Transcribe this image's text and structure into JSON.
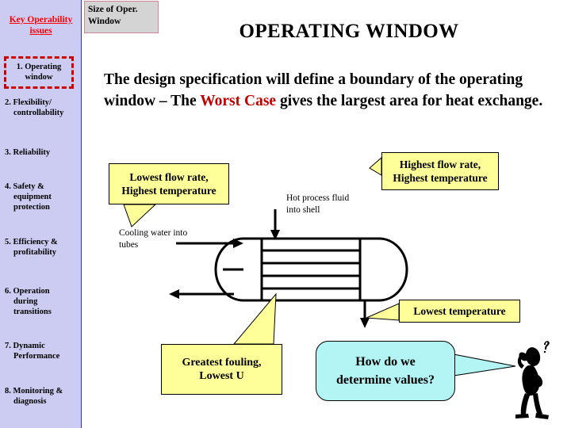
{
  "sidebar": {
    "title": "Key Operability issues",
    "items": [
      {
        "num": "1.",
        "line1": "Operating",
        "line2": "window",
        "line3": "",
        "highlighted": true
      },
      {
        "num": "2.",
        "line1": "Flexibility/",
        "line2": "controllability",
        "line3": "",
        "highlighted": false
      },
      {
        "num": "3.",
        "line1": "Reliability",
        "line2": "",
        "line3": "",
        "highlighted": false
      },
      {
        "num": "4.",
        "line1": "Safety &",
        "line2": "equipment",
        "line3": "protection",
        "highlighted": false
      },
      {
        "num": "5.",
        "line1": "Efficiency &",
        "line2": "profitability",
        "line3": "",
        "highlighted": false
      },
      {
        "num": "6.",
        "line1": "Operation",
        "line2": "during",
        "line3": "transitions",
        "highlighted": false
      },
      {
        "num": "7.",
        "line1": "Dynamic",
        "line2": "Performance",
        "line3": "",
        "highlighted": false
      },
      {
        "num": "8.",
        "line1": "Monitoring &",
        "line2": "diagnosis",
        "line3": "",
        "highlighted": false
      }
    ]
  },
  "size_badge": {
    "line1": "Size of Oper.",
    "line2": "Window"
  },
  "header": {
    "title": "OPERATING WINDOW"
  },
  "body": {
    "part1": "The design specification will define a boundary of the operating window – The ",
    "emphasis": "Worst Case",
    "part2": " gives the largest area for heat exchange."
  },
  "callouts": {
    "lowest_flow": {
      "line1": "Lowest flow rate,",
      "line2": "Highest temperature"
    },
    "highest_flow": {
      "line1": "Highest flow rate,",
      "line2": "Highest temperature"
    },
    "lowest_temp": {
      "line1": "Lowest temperature"
    },
    "fouling": {
      "line1": "Greatest fouling,",
      "line2": "Lowest U"
    }
  },
  "labels": {
    "cooling_water": {
      "line1": "Cooling water into",
      "line2": "tubes"
    },
    "hot_process": {
      "line1": "Hot process fluid",
      "line2": "into shell"
    }
  },
  "bubble": {
    "line1": "How do we",
    "line2": "determine values?"
  },
  "icons": {
    "person": "person-thinking-icon",
    "question_mark": "question-mark-icon"
  },
  "colors": {
    "sidebar_bg": "#ccccf2",
    "sidebar_title": "#ff0000",
    "highlight_dash": "#cc0000",
    "callout_bg": "#ffff99",
    "bubble_bg": "#b3f5f5",
    "emphasis_text": "#c00000",
    "badge_bg": "#d4d4d4",
    "badge_border": "#cc8899"
  }
}
